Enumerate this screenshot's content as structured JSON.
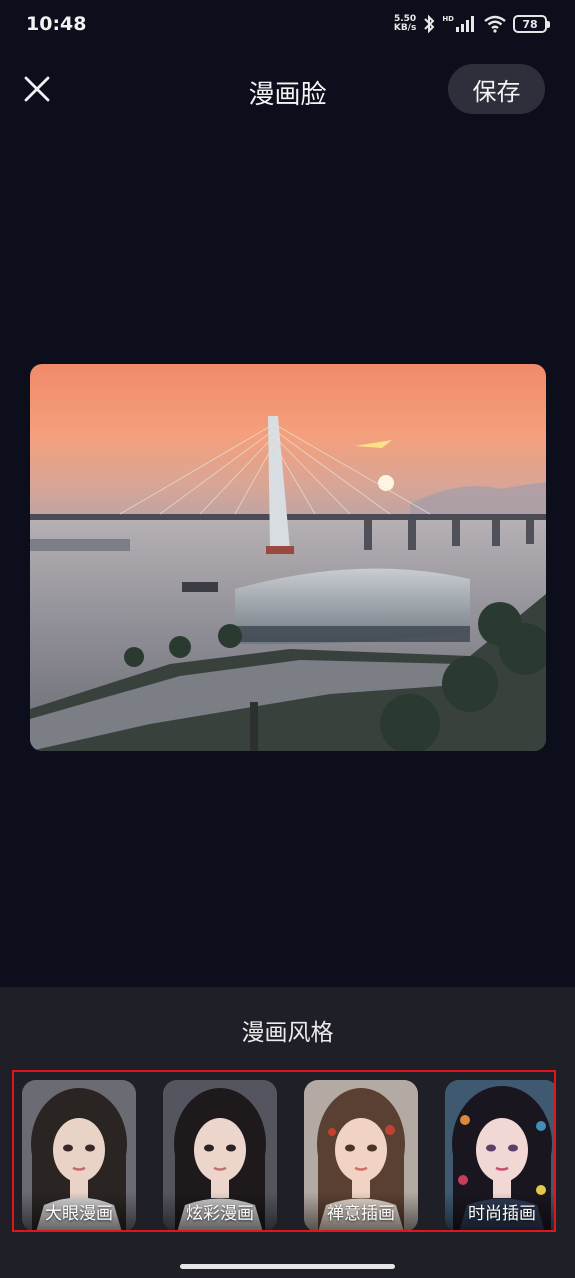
{
  "status_bar": {
    "time": "10:48",
    "net_speed_value": "5.50",
    "net_speed_unit": "KB/s",
    "signal_label": "HD",
    "battery": "78",
    "icons": [
      "bluetooth-icon",
      "signal-icon",
      "wifi-icon",
      "battery-icon"
    ]
  },
  "header": {
    "title": "漫画脸",
    "save_label": "保存",
    "close_icon": "close-icon"
  },
  "photo": {
    "subject": "bridge-sunset-photo"
  },
  "style_panel": {
    "title": "漫画风格",
    "styles": [
      {
        "label": "大眼漫画",
        "hair": "#2a2522",
        "skin": "#e9d2c6",
        "bg": "#6b6b73"
      },
      {
        "label": "炫彩漫画",
        "hair": "#1e1a1c",
        "skin": "#ecd6cc",
        "bg": "#55555f"
      },
      {
        "label": "禅意插画",
        "hair": "#5a4032",
        "skin": "#f0d3c2",
        "bg": "#b4aaa4"
      },
      {
        "label": "时尚插画",
        "hair": "#1a1620",
        "skin": "#f1d8d4",
        "bg": "#3f5a70"
      }
    ]
  },
  "colors": {
    "background": "#0c0e1b",
    "panel": "#1f1f28",
    "save_button": "#2d2f3b",
    "highlight_border": "#e0161b"
  }
}
